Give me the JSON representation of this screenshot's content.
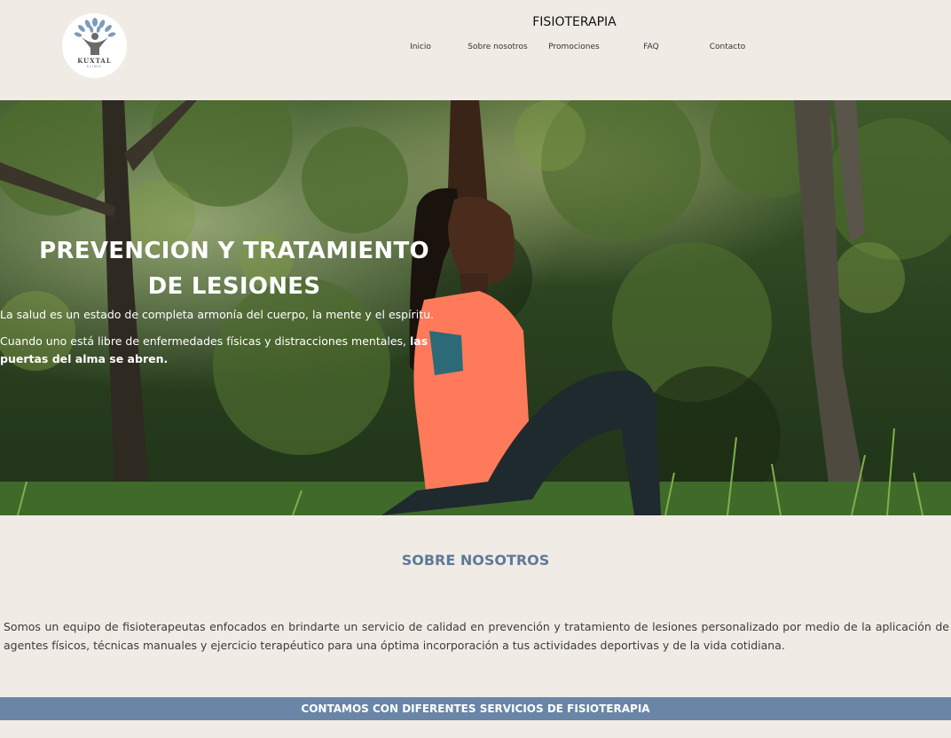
{
  "header": {
    "logo": {
      "name": "KUXTAL",
      "sub": "CLINIC"
    },
    "site_title": "FISIOTERAPIA",
    "nav": [
      {
        "label": "Inicio"
      },
      {
        "label": "Sobre nosotros"
      },
      {
        "label": "Promociones"
      },
      {
        "label": "FAQ"
      },
      {
        "label": "Contacto"
      }
    ]
  },
  "hero": {
    "title": "PREVENCION Y TRATAMIENTO DE LESIONES",
    "paragraph1": "La salud es un estado de completa armonía del cuerpo, la mente y el espíritu.",
    "paragraph2_plain": "Cuando uno está libre de enfermedades físicas y distracciones mentales, ",
    "paragraph2_bold": "las puertas del alma se abren."
  },
  "about": {
    "title": "SOBRE NOSOTROS",
    "text": "Somos un equipo de fisioterapeutas enfocados en brindarte un servicio de calidad en prevención y tratamiento de lesiones personalizado por medio de la aplicación de agentes físicos, técnicas manuales y ejercicio terapéutico para una óptima incorporación a tus actividades deportivas y de la vida cotidiana."
  },
  "services": {
    "title": "CONTAMOS CON DIFERENTES SERVICIOS DE FISIOTERAPIA"
  },
  "colors": {
    "background": "#f0ece5",
    "accent_blue": "#5e7a9a",
    "services_bar": "#6986a6",
    "shirt_orange": "#ff7a5a"
  },
  "icons": {
    "logo": "tree-person-icon"
  }
}
